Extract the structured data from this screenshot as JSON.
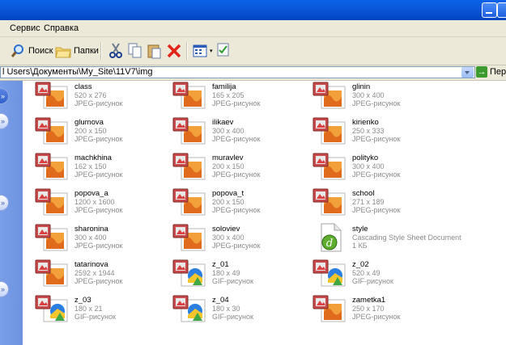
{
  "window": {
    "colors": {
      "titlebar": "#0b57d9",
      "chrome": "#ece9d8",
      "pane": "#7a9ee8"
    }
  },
  "menu": {
    "items": [
      "Сервис",
      "Справка"
    ]
  },
  "toolbar": {
    "search_label": "Поиск",
    "folders_label": "Папки"
  },
  "address": {
    "path": "l Users\\Документы\\My_Site\\11V7\\img",
    "go_label": "Пере"
  },
  "files": [
    {
      "name": "class",
      "dims": "520 x 276",
      "type": "JPEG-рисунок",
      "icon": "jpeg-image-icon"
    },
    {
      "name": "familija",
      "dims": "165 x 205",
      "type": "JPEG-рисунок",
      "icon": "jpeg-image-icon"
    },
    {
      "name": "glinin",
      "dims": "300 x 400",
      "type": "JPEG-рисунок",
      "icon": "jpeg-image-icon"
    },
    {
      "name": "glumova",
      "dims": "200 x 150",
      "type": "JPEG-рисунок",
      "icon": "jpeg-image-icon"
    },
    {
      "name": "ilikaev",
      "dims": "300 x 400",
      "type": "JPEG-рисунок",
      "icon": "jpeg-image-icon"
    },
    {
      "name": "kirienko",
      "dims": "250 x 333",
      "type": "JPEG-рисунок",
      "icon": "jpeg-image-icon"
    },
    {
      "name": "machkhina",
      "dims": "162 x 150",
      "type": "JPEG-рисунок",
      "icon": "jpeg-image-icon"
    },
    {
      "name": "muravlev",
      "dims": "200 x 150",
      "type": "JPEG-рисунок",
      "icon": "jpeg-image-icon"
    },
    {
      "name": "polityko",
      "dims": "300 x 400",
      "type": "JPEG-рисунок",
      "icon": "jpeg-image-icon"
    },
    {
      "name": "popova_a",
      "dims": "1200 x 1600",
      "type": "JPEG-рисунок",
      "icon": "jpeg-image-icon"
    },
    {
      "name": "popova_t",
      "dims": "200 x 150",
      "type": "JPEG-рисунок",
      "icon": "jpeg-image-icon"
    },
    {
      "name": "school",
      "dims": "271 x 189",
      "type": "JPEG-рисунок",
      "icon": "jpeg-image-icon"
    },
    {
      "name": "sharonina",
      "dims": "300 x 400",
      "type": "JPEG-рисунок",
      "icon": "jpeg-image-icon"
    },
    {
      "name": "soloviev",
      "dims": "300 x 400",
      "type": "JPEG-рисунок",
      "icon": "jpeg-image-icon"
    },
    {
      "name": "style",
      "dims": "Cascading Style Sheet Document",
      "type": "1 КБ",
      "icon": "css-document-icon"
    },
    {
      "name": "tatarinova",
      "dims": "2592 x 1944",
      "type": "JPEG-рисунок",
      "icon": "jpeg-image-icon"
    },
    {
      "name": "z_01",
      "dims": "180 x 49",
      "type": "GIF-рисунок",
      "icon": "gif-image-icon"
    },
    {
      "name": "z_02",
      "dims": "520 x 49",
      "type": "GIF-рисунок",
      "icon": "gif-image-icon"
    },
    {
      "name": "z_03",
      "dims": "180 x 21",
      "type": "GIF-рисунок",
      "icon": "gif-image-icon"
    },
    {
      "name": "z_04",
      "dims": "180 x 30",
      "type": "GIF-рисунок",
      "icon": "gif-image-icon"
    },
    {
      "name": "zametka1",
      "dims": "250 x 170",
      "type": "JPEG-рисунок",
      "icon": "jpeg-image-icon"
    }
  ]
}
